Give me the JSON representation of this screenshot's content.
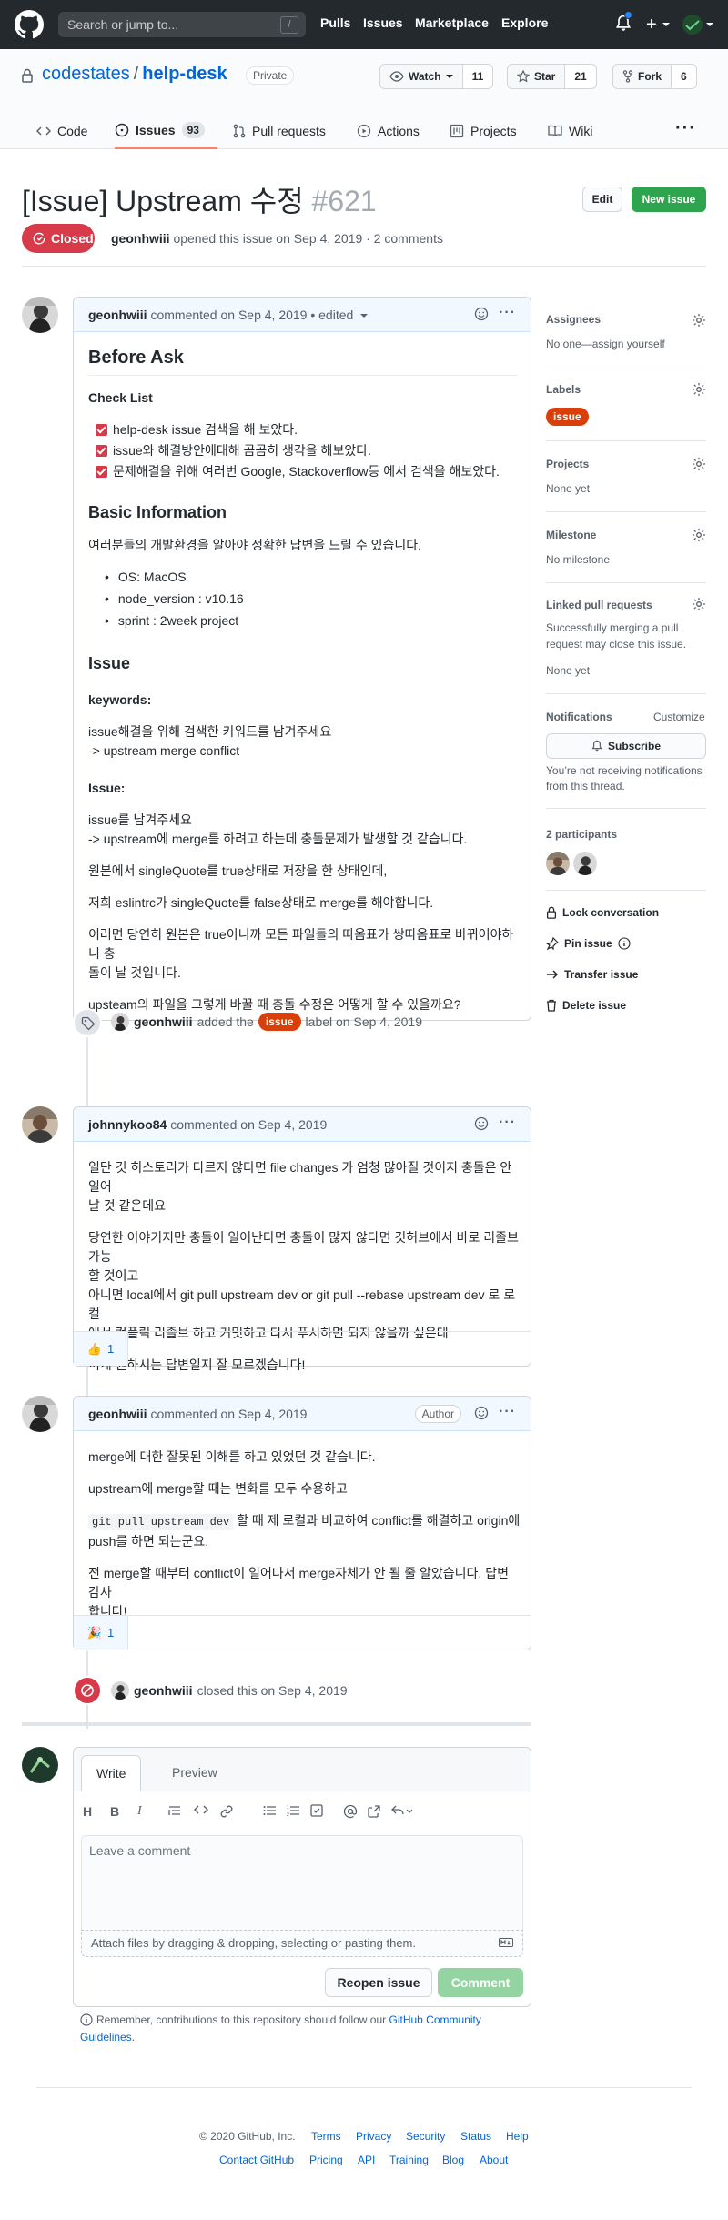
{
  "header": {
    "search_placeholder": "Search or jump to...",
    "search_shortcut": "/",
    "nav": [
      "Pulls",
      "Issues",
      "Marketplace",
      "Explore"
    ]
  },
  "repo": {
    "owner": "codestates",
    "name": "help-desk",
    "visibility": "Private",
    "watch": {
      "label": "Watch",
      "count": "11"
    },
    "star": {
      "label": "Star",
      "count": "21"
    },
    "fork": {
      "label": "Fork",
      "count": "6"
    },
    "tabs": [
      {
        "label": "Code"
      },
      {
        "label": "Issues",
        "count": "93"
      },
      {
        "label": "Pull requests"
      },
      {
        "label": "Actions"
      },
      {
        "label": "Projects"
      },
      {
        "label": "Wiki"
      }
    ]
  },
  "issue": {
    "title": "[Issue] Upstream 수정",
    "number": "#621",
    "edit_label": "Edit",
    "new_issue_label": "New issue",
    "state": "Closed",
    "author": "geonhwiii",
    "meta_rest": "opened this issue on Sep 4, 2019 · 2 comments"
  },
  "comments": [
    {
      "author": "geonhwiii",
      "head_rest": "commented on Sep 4, 2019 • edited",
      "body": {
        "h_before": "Before Ask",
        "h_checklist": "Check List",
        "checks": [
          "help-desk issue 검색을 해 보았다.",
          "issue와 해결방안에대해 곰곰히 생각을 해보았다.",
          "문제해결을 위해 여러번 Google, Stackoverflow등 에서 검색을 해보았다."
        ],
        "h_basic": "Basic Information",
        "basic_intro": "여러분들의 개발환경을 알아야 정확한 답변을 드릴 수 있습니다.",
        "env": [
          "OS: MacOS",
          "node_version : v10.16",
          "sprint : 2week project"
        ],
        "h_issue": "Issue",
        "h_keywords": "keywords:",
        "keywords_1": "issue해결을 위해 검색한 키워드를 남겨주세요",
        "keywords_2": "-> upstream merge conflict",
        "h_issue_sub": "Issue:",
        "issue_1": "issue를 남겨주세요",
        "issue_2": "-> upstream에 merge를 하려고 하는데 충돌문제가 발생할 것 같습니다.",
        "p1": "원본에서 singleQuote를 true상태로 저장을 한 상태인데,",
        "p2": "저희 eslintrc가 singleQuote를 false상태로 merge를 해야합니다.",
        "p3a": "이러면 당연히 원본은 true이니까 모든 파일들의 따옴표가 쌍따옴표로 바뀌어야하니 충",
        "p3b": "돌이 날 것입니다.",
        "p4": "upsteam의 파일을 그렇게 바꿀 때 충돌 수정은 어떻게 할 수 있을까요?"
      }
    },
    {
      "author": "johnnykoo84",
      "head_rest": "commented on Sep 4, 2019",
      "lines": [
        "일단 깃 히스토리가 다르지 않다면 file changes 가 엄청 많아질 것이지 충돌은 안 일어",
        "날 것 같은데요",
        "당연한 이야기지만 충돌이 일어난다면 충돌이 많지 않다면 깃허브에서 바로 리졸브 가능",
        "할 것이고",
        "아니면 local에서 git pull upstream dev or git pull --rebase upstream dev 로 로컬",
        "에서 컨플릭 리졸브 하고 커밋하고 다시 푸시하면 되지 않을까 싶은데",
        "이게 원하시는 답변일지 잘 모르겠습니다!"
      ],
      "reaction": {
        "emoji": "👍",
        "count": "1"
      }
    },
    {
      "author": "geonhwiii",
      "head_rest": "commented on Sep 4, 2019",
      "badge": "Author",
      "lines": [
        "merge에 대한 잘못된 이해를 하고 있었던 것 같습니다.",
        "upstream에 merge할 때는 변화를 모두 수용하고",
        "git pull upstream dev",
        "할 때 제 로컬과 비교하여 conflict를 해결하고 origin에",
        "push를 하면 되는군요.",
        "전 merge할 때부터 conflict이 일어나서 merge자체가 안 될 줄 알았습니다. 답변 감사",
        "합니다!"
      ],
      "reaction": {
        "emoji": "🎉",
        "count": "1"
      }
    }
  ],
  "events": {
    "labeled": {
      "actor": "geonhwiii",
      "pre": "added the",
      "label": "issue",
      "post": "label on Sep 4, 2019"
    },
    "closed": {
      "actor": "geonhwiii",
      "rest": "closed this on Sep 4, 2019"
    }
  },
  "sidebar": {
    "assignees": {
      "title": "Assignees",
      "value": "No one—assign yourself"
    },
    "labels": {
      "title": "Labels",
      "value": "issue"
    },
    "projects": {
      "title": "Projects",
      "value": "None yet"
    },
    "milestone": {
      "title": "Milestone",
      "value": "No milestone"
    },
    "linked": {
      "title": "Linked pull requests",
      "desc_1": "Successfully merging a pull",
      "desc_2": "request may close this issue.",
      "value": "None yet"
    },
    "notifications": {
      "title": "Notifications",
      "customize": "Customize",
      "subscribe": "Subscribe",
      "desc_1": "You’re not receiving notifications",
      "desc_2": "from this thread."
    },
    "participants": "2 participants",
    "actions": [
      "Lock conversation",
      "Pin issue",
      "Transfer issue",
      "Delete issue"
    ]
  },
  "composer": {
    "tab_write": "Write",
    "tab_preview": "Preview",
    "placeholder": "Leave a comment",
    "attach": "Attach files by dragging & dropping, selecting or pasting them.",
    "reopen": "Reopen issue",
    "submit": "Comment",
    "remember_pre": "Remember, contributions to this repository should follow our",
    "remember_link_1": "GitHub Community",
    "remember_link_2": "Guidelines",
    "remember_post": "."
  },
  "footer": {
    "copyright": "© 2020 GitHub, Inc.",
    "row1": [
      "Terms",
      "Privacy",
      "Security",
      "Status",
      "Help"
    ],
    "row2": [
      "Contact GitHub",
      "Pricing",
      "API",
      "Training",
      "Blog",
      "About"
    ]
  },
  "colors": {
    "closed": "#d73a49",
    "label_issue": "#d93f0b",
    "link": "#0366d6",
    "green": "#2ea44f"
  }
}
